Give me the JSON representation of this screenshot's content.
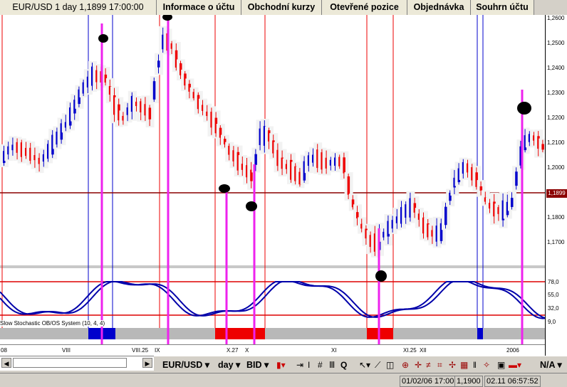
{
  "tabs": [
    {
      "label": "EUR/USD 1 day 1,1899 17:00:00"
    },
    {
      "label": "Informace o účtu"
    },
    {
      "label": "Obchodní kurzy"
    },
    {
      "label": "Otevřené pozice"
    },
    {
      "label": "Objednávka"
    },
    {
      "label": "Souhrn účtu"
    }
  ],
  "yaxis": {
    "price_ticks": [
      "1,2600",
      "1,2500",
      "1,2400",
      "1,2300",
      "1,2200",
      "1,2100",
      "1,2000",
      "1,1800",
      "1,1700"
    ],
    "current_price": "1,1899",
    "indicator_ticks": [
      "78,0",
      "55,0",
      "32,0",
      "9,0"
    ]
  },
  "xaxis": {
    "ticks": [
      "08",
      "VIII",
      "VIII.25",
      "IX",
      "X.27",
      "X",
      "XI",
      "XI.25",
      "XII",
      "2006"
    ]
  },
  "indicator": {
    "label": "Slow Stochastic OB/OS System (10, 4, 4)"
  },
  "toolbar": {
    "symbol": "EUR/USD",
    "period": "day",
    "price_side": "BID",
    "mode": "N/A"
  },
  "status": {
    "cursor": "01/02/06 17:00",
    "price": "1,1900",
    "clock": "02.11 06:57:52"
  },
  "colors": {
    "bull": "#0000cc",
    "bear": "#ee0000",
    "magenta": "#ee22ee",
    "stoch": "#0000aa",
    "ob_os_line": "#dd0000",
    "current_line": "#8b0000"
  }
}
